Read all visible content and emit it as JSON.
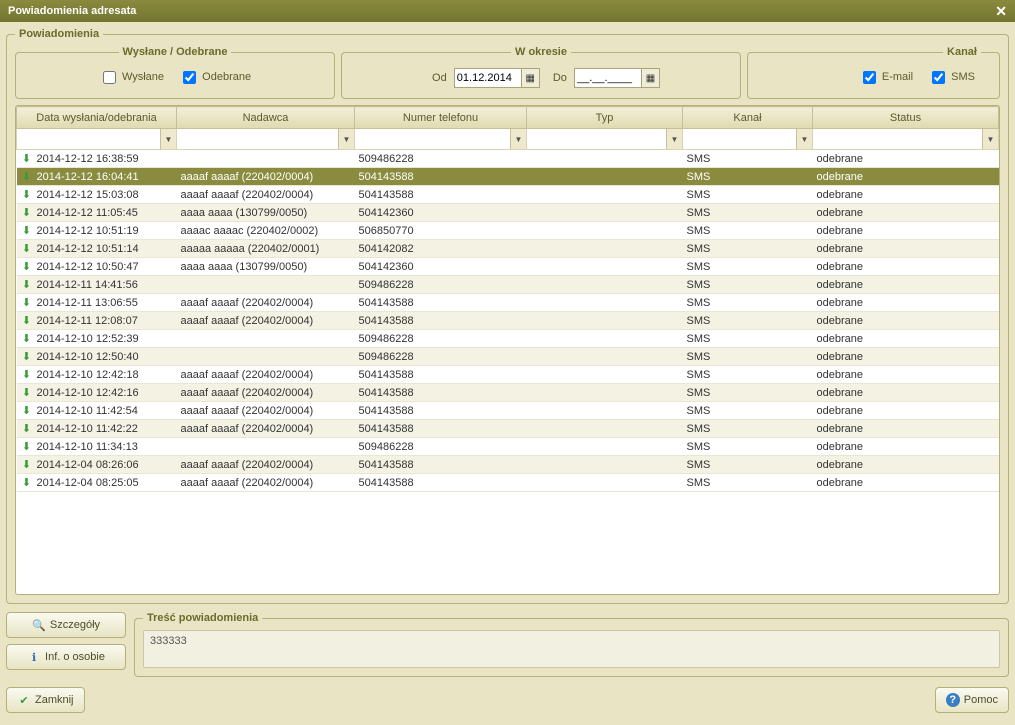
{
  "window": {
    "title": "Powiadomienia adresata"
  },
  "section": {
    "title": "Powiadomienia"
  },
  "filters": {
    "sentReceived": {
      "legend": "Wysłane / Odebrane",
      "sent_label": "Wysłane",
      "received_label": "Odebrane",
      "sent_checked": false,
      "received_checked": true
    },
    "period": {
      "legend": "W okresie",
      "from_label": "Od",
      "to_label": "Do",
      "from_value": "01.12.2014",
      "to_value": "__.__.____"
    },
    "channel": {
      "legend": "Kanał",
      "email_label": "E-mail",
      "sms_label": "SMS",
      "email_checked": true,
      "sms_checked": true
    }
  },
  "columns": {
    "date": "Data wysłania/odebrania",
    "sender": "Nadawca",
    "phone": "Numer telefonu",
    "type": "Typ",
    "channel": "Kanał",
    "status": "Status"
  },
  "rows": [
    {
      "date": "2014-12-12 16:38:59",
      "sender": "",
      "phone": "509486228",
      "type": "",
      "channel": "SMS",
      "status": "odebrane",
      "selected": false
    },
    {
      "date": "2014-12-12 16:04:41",
      "sender": "aaaaf aaaaf (220402/0004)",
      "phone": "504143588",
      "type": "",
      "channel": "SMS",
      "status": "odebrane",
      "selected": true
    },
    {
      "date": "2014-12-12 15:03:08",
      "sender": "aaaaf aaaaf (220402/0004)",
      "phone": "504143588",
      "type": "",
      "channel": "SMS",
      "status": "odebrane",
      "selected": false
    },
    {
      "date": "2014-12-12 11:05:45",
      "sender": "aaaa aaaa (130799/0050)",
      "phone": "504142360",
      "type": "",
      "channel": "SMS",
      "status": "odebrane",
      "selected": false
    },
    {
      "date": "2014-12-12 10:51:19",
      "sender": "aaaac aaaac (220402/0002)",
      "phone": "506850770",
      "type": "",
      "channel": "SMS",
      "status": "odebrane",
      "selected": false
    },
    {
      "date": "2014-12-12 10:51:14",
      "sender": "aaaaa aaaaa (220402/0001)",
      "phone": "504142082",
      "type": "",
      "channel": "SMS",
      "status": "odebrane",
      "selected": false
    },
    {
      "date": "2014-12-12 10:50:47",
      "sender": "aaaa aaaa (130799/0050)",
      "phone": "504142360",
      "type": "",
      "channel": "SMS",
      "status": "odebrane",
      "selected": false
    },
    {
      "date": "2014-12-11 14:41:56",
      "sender": "",
      "phone": "509486228",
      "type": "",
      "channel": "SMS",
      "status": "odebrane",
      "selected": false
    },
    {
      "date": "2014-12-11 13:06:55",
      "sender": "aaaaf aaaaf (220402/0004)",
      "phone": "504143588",
      "type": "",
      "channel": "SMS",
      "status": "odebrane",
      "selected": false
    },
    {
      "date": "2014-12-11 12:08:07",
      "sender": "aaaaf aaaaf (220402/0004)",
      "phone": "504143588",
      "type": "",
      "channel": "SMS",
      "status": "odebrane",
      "selected": false
    },
    {
      "date": "2014-12-10 12:52:39",
      "sender": "",
      "phone": "509486228",
      "type": "",
      "channel": "SMS",
      "status": "odebrane",
      "selected": false
    },
    {
      "date": "2014-12-10 12:50:40",
      "sender": "",
      "phone": "509486228",
      "type": "",
      "channel": "SMS",
      "status": "odebrane",
      "selected": false
    },
    {
      "date": "2014-12-10 12:42:18",
      "sender": "aaaaf aaaaf (220402/0004)",
      "phone": "504143588",
      "type": "",
      "channel": "SMS",
      "status": "odebrane",
      "selected": false
    },
    {
      "date": "2014-12-10 12:42:16",
      "sender": "aaaaf aaaaf (220402/0004)",
      "phone": "504143588",
      "type": "",
      "channel": "SMS",
      "status": "odebrane",
      "selected": false
    },
    {
      "date": "2014-12-10 11:42:54",
      "sender": "aaaaf aaaaf (220402/0004)",
      "phone": "504143588",
      "type": "",
      "channel": "SMS",
      "status": "odebrane",
      "selected": false
    },
    {
      "date": "2014-12-10 11:42:22",
      "sender": "aaaaf aaaaf (220402/0004)",
      "phone": "504143588",
      "type": "",
      "channel": "SMS",
      "status": "odebrane",
      "selected": false
    },
    {
      "date": "2014-12-10 11:34:13",
      "sender": "",
      "phone": "509486228",
      "type": "",
      "channel": "SMS",
      "status": "odebrane",
      "selected": false
    },
    {
      "date": "2014-12-04 08:26:06",
      "sender": "aaaaf aaaaf (220402/0004)",
      "phone": "504143588",
      "type": "",
      "channel": "SMS",
      "status": "odebrane",
      "selected": false
    },
    {
      "date": "2014-12-04 08:25:05",
      "sender": "aaaaf aaaaf (220402/0004)",
      "phone": "504143588",
      "type": "",
      "channel": "SMS",
      "status": "odebrane",
      "selected": false
    }
  ],
  "message": {
    "legend": "Treść powiadomienia",
    "text": "333333"
  },
  "buttons": {
    "details": "Szczegóły",
    "person_info": "Inf. o osobie",
    "close": "Zamknij",
    "help": "Pomoc"
  },
  "icons": {
    "row": "⬇",
    "magnifier": "🔍",
    "info": "ℹ",
    "check": "✔",
    "help": "?",
    "calendar": "▦",
    "dropdown": "▼"
  }
}
